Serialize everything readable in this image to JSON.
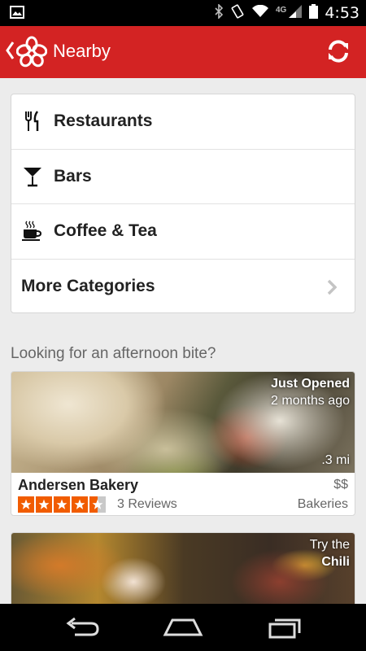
{
  "status_bar": {
    "time": "4:53",
    "network": "4G",
    "icons": [
      "image-icon",
      "bluetooth-icon",
      "rotation-icon",
      "wifi-icon",
      "signal-icon",
      "battery-icon"
    ]
  },
  "app_bar": {
    "title": "Nearby",
    "brand_color": "#d32323",
    "icons": [
      "back-chevron-icon",
      "yelp-logo-icon",
      "refresh-icon"
    ]
  },
  "categories": [
    {
      "label": "Restaurants",
      "icon": "fork-knife-icon"
    },
    {
      "label": "Bars",
      "icon": "cocktail-icon"
    },
    {
      "label": "Coffee & Tea",
      "icon": "coffee-cup-icon"
    },
    {
      "label": "More Categories",
      "icon": "chevron-right-icon"
    }
  ],
  "section_title": "Looking for an afternoon bite?",
  "businesses": [
    {
      "overlay_top": "Just Opened",
      "overlay_sub": "2 months ago",
      "distance": ".3 mi",
      "name": "Andersen Bakery",
      "price": "$$",
      "rating": 4.5,
      "reviews": "3 Reviews",
      "category": "Bakeries"
    },
    {
      "overlay_top": "Try the",
      "overlay_sub": "Chili"
    }
  ],
  "nav_bar": {
    "icons": [
      "back-nav-icon",
      "home-nav-icon",
      "recents-nav-icon"
    ]
  },
  "colors": {
    "star": "#f15c00",
    "app_bar": "#d32323"
  }
}
